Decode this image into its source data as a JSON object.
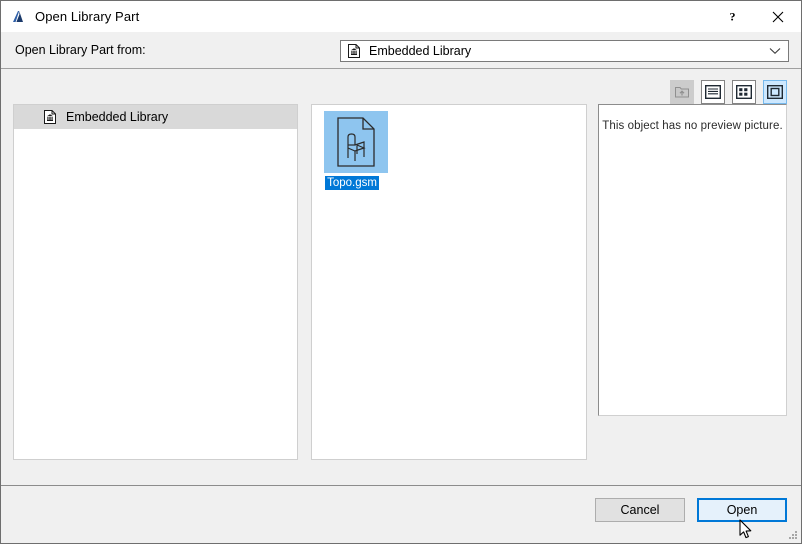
{
  "window": {
    "title": "Open Library Part",
    "icon": "archicad-logo-icon",
    "help_label": "?",
    "close_label": "✕"
  },
  "source": {
    "label": "Open Library Part from:",
    "combo_value": "Embedded Library",
    "combo_icon": "library-document-icon",
    "combo_arrow_icon": "chevron-down-icon"
  },
  "toolbar": {
    "buttons": [
      {
        "name": "go-up-folder-button",
        "icon": "folder-up-arrow-icon",
        "state": "disabled"
      },
      {
        "name": "list-view-button",
        "icon": "list-view-icon",
        "state": "normal"
      },
      {
        "name": "details-view-button",
        "icon": "grid-view-icon",
        "state": "normal"
      },
      {
        "name": "large-icons-view-button",
        "icon": "large-icon-view-icon",
        "state": "active"
      }
    ]
  },
  "tree": {
    "items": [
      {
        "label": "Embedded Library",
        "icon": "library-document-icon",
        "selected": true
      }
    ]
  },
  "files": {
    "items": [
      {
        "name": "Topo.gsm",
        "icon": "gsm-object-document-icon",
        "selected": true
      }
    ]
  },
  "preview": {
    "message": "This object has no preview picture."
  },
  "footer": {
    "cancel_label": "Cancel",
    "open_label": "Open"
  },
  "colors": {
    "accent": "#0078d7",
    "selection_thumb": "#8ec5ef",
    "tree_selection": "#d9d9d9",
    "dialog_bg": "#f0f0f0",
    "default_button_bg": "#e5f1fb"
  }
}
